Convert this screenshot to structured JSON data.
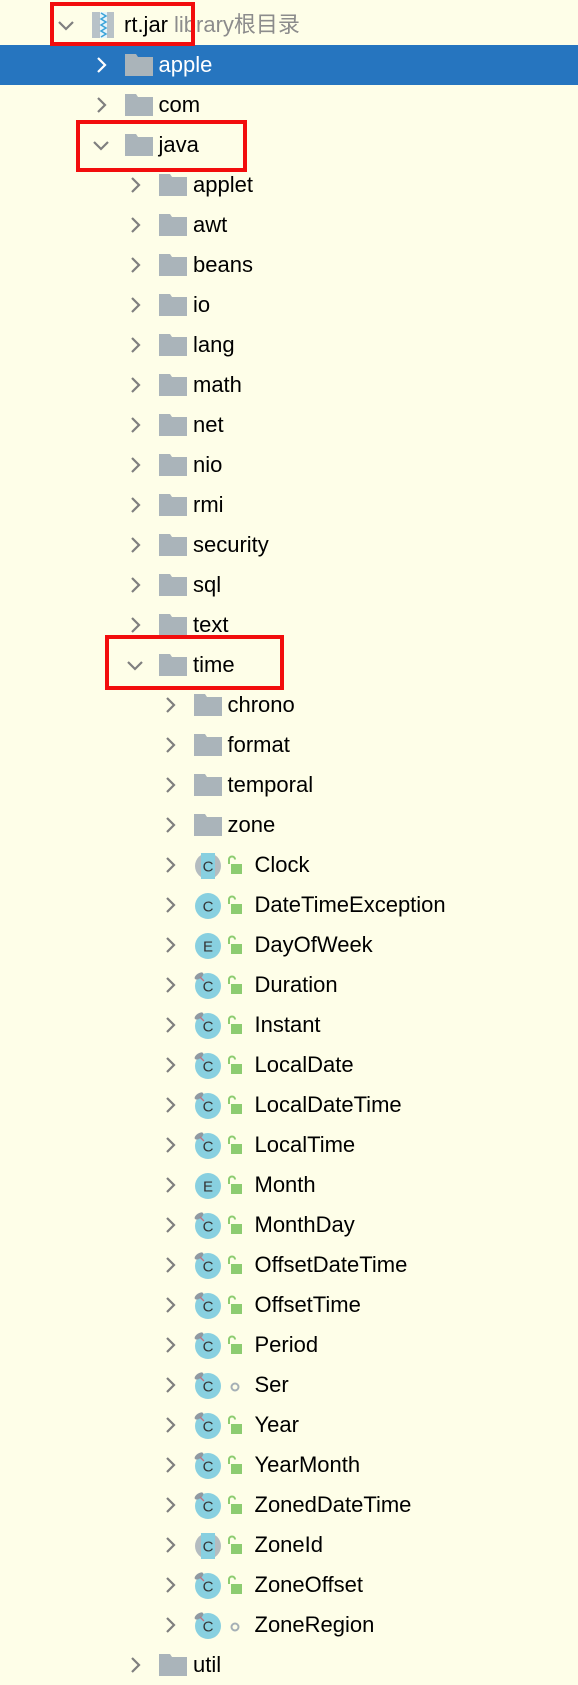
{
  "colors": {
    "background": "#fefee8",
    "selection": "#2675bf",
    "folder": "#aab4ba",
    "class_icon": "#88d0e0",
    "lock": "#8ccc70",
    "highlight_box": "#f20d0d"
  },
  "tree": [
    {
      "label": "rt.jar",
      "hint": "library根目录",
      "level": 0,
      "expanded": true,
      "icon": "jar-icon",
      "highlighted": true
    },
    {
      "label": "apple",
      "level": 1,
      "expanded": false,
      "icon": "folder-icon",
      "selected": true
    },
    {
      "label": "com",
      "level": 1,
      "expanded": false,
      "icon": "folder-icon"
    },
    {
      "label": "java",
      "level": 1,
      "expanded": true,
      "icon": "folder-icon",
      "highlighted": true
    },
    {
      "label": "applet",
      "level": 2,
      "expanded": false,
      "icon": "folder-icon"
    },
    {
      "label": "awt",
      "level": 2,
      "expanded": false,
      "icon": "folder-icon"
    },
    {
      "label": "beans",
      "level": 2,
      "expanded": false,
      "icon": "folder-icon"
    },
    {
      "label": "io",
      "level": 2,
      "expanded": false,
      "icon": "folder-icon"
    },
    {
      "label": "lang",
      "level": 2,
      "expanded": false,
      "icon": "folder-icon"
    },
    {
      "label": "math",
      "level": 2,
      "expanded": false,
      "icon": "folder-icon"
    },
    {
      "label": "net",
      "level": 2,
      "expanded": false,
      "icon": "folder-icon"
    },
    {
      "label": "nio",
      "level": 2,
      "expanded": false,
      "icon": "folder-icon"
    },
    {
      "label": "rmi",
      "level": 2,
      "expanded": false,
      "icon": "folder-icon"
    },
    {
      "label": "security",
      "level": 2,
      "expanded": false,
      "icon": "folder-icon"
    },
    {
      "label": "sql",
      "level": 2,
      "expanded": false,
      "icon": "folder-icon"
    },
    {
      "label": "text",
      "level": 2,
      "expanded": false,
      "icon": "folder-icon"
    },
    {
      "label": "time",
      "level": 2,
      "expanded": true,
      "icon": "folder-icon",
      "highlighted": true
    },
    {
      "label": "chrono",
      "level": 3,
      "expanded": false,
      "icon": "folder-icon"
    },
    {
      "label": "format",
      "level": 3,
      "expanded": false,
      "icon": "folder-icon"
    },
    {
      "label": "temporal",
      "level": 3,
      "expanded": false,
      "icon": "folder-icon"
    },
    {
      "label": "zone",
      "level": 3,
      "expanded": false,
      "icon": "folder-icon"
    },
    {
      "label": "Clock",
      "level": 3,
      "icon": "abstract-class-icon",
      "letter": "C",
      "visibility": "public"
    },
    {
      "label": "DateTimeException",
      "level": 3,
      "icon": "class-icon",
      "letter": "C",
      "visibility": "public"
    },
    {
      "label": "DayOfWeek",
      "level": 3,
      "icon": "enum-icon",
      "letter": "E",
      "visibility": "public"
    },
    {
      "label": "Duration",
      "level": 3,
      "icon": "final-class-icon",
      "letter": "C",
      "visibility": "public"
    },
    {
      "label": "Instant",
      "level": 3,
      "icon": "final-class-icon",
      "letter": "C",
      "visibility": "public"
    },
    {
      "label": "LocalDate",
      "level": 3,
      "icon": "final-class-icon",
      "letter": "C",
      "visibility": "public"
    },
    {
      "label": "LocalDateTime",
      "level": 3,
      "icon": "final-class-icon",
      "letter": "C",
      "visibility": "public"
    },
    {
      "label": "LocalTime",
      "level": 3,
      "icon": "final-class-icon",
      "letter": "C",
      "visibility": "public"
    },
    {
      "label": "Month",
      "level": 3,
      "icon": "enum-icon",
      "letter": "E",
      "visibility": "public"
    },
    {
      "label": "MonthDay",
      "level": 3,
      "icon": "final-class-icon",
      "letter": "C",
      "visibility": "public"
    },
    {
      "label": "OffsetDateTime",
      "level": 3,
      "icon": "final-class-icon",
      "letter": "C",
      "visibility": "public"
    },
    {
      "label": "OffsetTime",
      "level": 3,
      "icon": "final-class-icon",
      "letter": "C",
      "visibility": "public"
    },
    {
      "label": "Period",
      "level": 3,
      "icon": "final-class-icon",
      "letter": "C",
      "visibility": "public"
    },
    {
      "label": "Ser",
      "level": 3,
      "icon": "final-class-icon",
      "letter": "C",
      "visibility": "package"
    },
    {
      "label": "Year",
      "level": 3,
      "icon": "final-class-icon",
      "letter": "C",
      "visibility": "public"
    },
    {
      "label": "YearMonth",
      "level": 3,
      "icon": "final-class-icon",
      "letter": "C",
      "visibility": "public"
    },
    {
      "label": "ZonedDateTime",
      "level": 3,
      "icon": "final-class-icon",
      "letter": "C",
      "visibility": "public"
    },
    {
      "label": "ZoneId",
      "level": 3,
      "icon": "abstract-class-icon",
      "letter": "C",
      "visibility": "public"
    },
    {
      "label": "ZoneOffset",
      "level": 3,
      "icon": "final-class-icon",
      "letter": "C",
      "visibility": "public"
    },
    {
      "label": "ZoneRegion",
      "level": 3,
      "icon": "final-class-icon",
      "letter": "C",
      "visibility": "package"
    },
    {
      "label": "util",
      "level": 2,
      "expanded": false,
      "icon": "folder-icon"
    }
  ]
}
